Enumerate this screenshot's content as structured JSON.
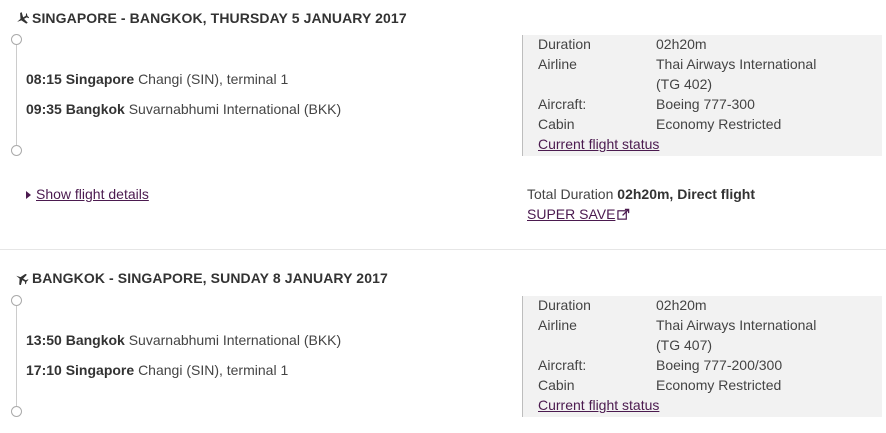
{
  "segments": [
    {
      "title": "SINGAPORE - BANGKOK, THURSDAY 5 JANUARY 2017",
      "departure": {
        "time": "08:15",
        "city": "Singapore",
        "airport": "Changi (SIN), terminal 1"
      },
      "arrival": {
        "time": "09:35",
        "city": "Bangkok",
        "airport": "Suvarnabhumi International (BKK)"
      },
      "info": {
        "duration_label": "Duration",
        "duration": "02h20m",
        "airline_label": "Airline",
        "airline": "Thai Airways International",
        "flight_no": "(TG 402)",
        "aircraft_label": "Aircraft:",
        "aircraft": "Boeing 777-300",
        "cabin_label": "Cabin",
        "cabin": "Economy Restricted",
        "status_link": "Current flight status"
      },
      "details_link": "Show flight details",
      "total_label": "Total Duration",
      "total_value": "02h20m, Direct flight",
      "fare_link": "SUPER SAVE"
    },
    {
      "title": "BANGKOK - SINGAPORE, SUNDAY 8 JANUARY 2017",
      "departure": {
        "time": "13:50",
        "city": "Bangkok",
        "airport": "Suvarnabhumi International (BKK)"
      },
      "arrival": {
        "time": "17:10",
        "city": "Singapore",
        "airport": "Changi (SIN), terminal 1"
      },
      "info": {
        "duration_label": "Duration",
        "duration": "02h20m",
        "airline_label": "Airline",
        "airline": "Thai Airways International",
        "flight_no": "(TG 407)",
        "aircraft_label": "Aircraft:",
        "aircraft": "Boeing 777-200/300",
        "cabin_label": "Cabin",
        "cabin": "Economy Restricted",
        "status_link": "Current flight status"
      }
    }
  ],
  "icons": {
    "plane": "plane-icon",
    "external": "external-link-icon"
  },
  "colors": {
    "link": "#4b1a4f",
    "text": "#333333",
    "panel": "#f2f2f2"
  }
}
